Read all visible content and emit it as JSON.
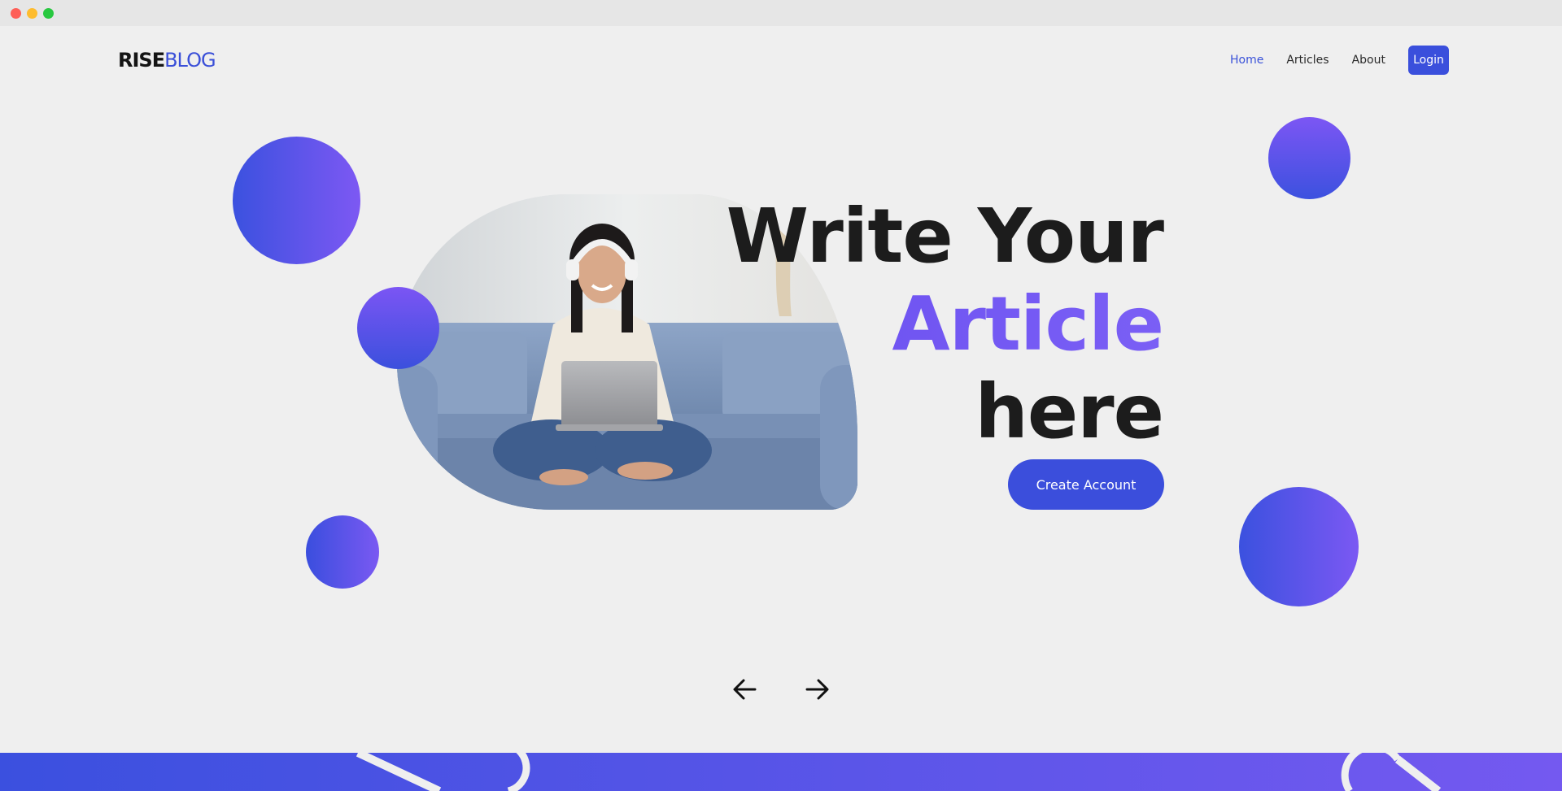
{
  "window": {
    "controls": [
      "close",
      "minimize",
      "zoom"
    ]
  },
  "brand": {
    "part1": "RISE",
    "part2": "BLOG"
  },
  "nav": {
    "items": [
      {
        "label": "Home",
        "active": true
      },
      {
        "label": "Articles",
        "active": false
      },
      {
        "label": "About",
        "active": false
      }
    ],
    "login_label": "Login"
  },
  "hero": {
    "line1": "Write Your",
    "line2": "Article",
    "line3": "here",
    "cta_label": "Create Account",
    "image_icon": "woman-on-couch-with-laptop-photo"
  },
  "carousel": {
    "prev_icon": "arrow-left-icon",
    "next_icon": "arrow-right-icon"
  },
  "colors": {
    "accent": "#3b4edc",
    "accent_purple": "#7b58f3",
    "background": "#efefef",
    "text": "#1c1c1c"
  }
}
